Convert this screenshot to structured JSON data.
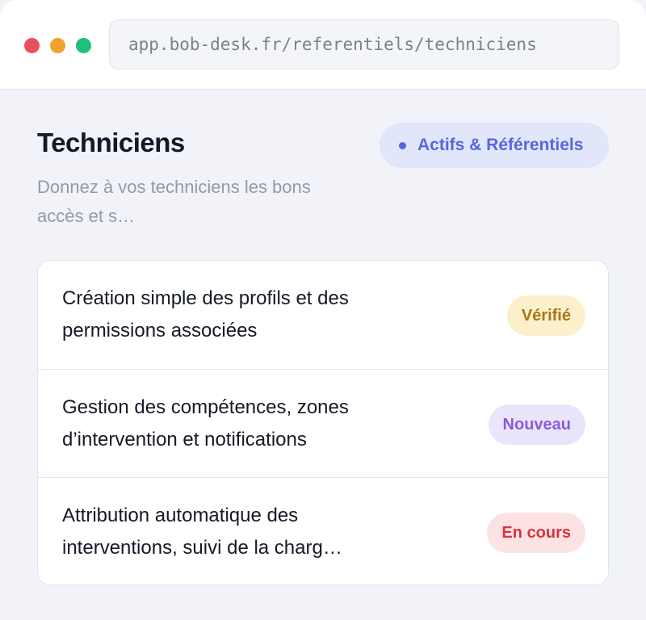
{
  "browser": {
    "url": "app.bob-desk.fr/referentiels/techniciens"
  },
  "header": {
    "title": "Techniciens",
    "description": "Donnez à vos techniciens les bons accès et s…",
    "category_badge": "Actifs & Référentiels",
    "category_color": "#5866e0"
  },
  "features": [
    {
      "text": "Création simple des profils et des permissions associées",
      "status": "Vérifié"
    },
    {
      "text": "Gestion des compétences, zones d’intervention et notifications",
      "status": "Nouveau"
    },
    {
      "text": "Attribution automatique des interventions, suivi de la charg…",
      "status": "En cours"
    }
  ],
  "status_colors": {
    "Vérifié": "#a87613",
    "Nouveau": "#8b5bdc",
    "En cours": "#d8333f"
  }
}
